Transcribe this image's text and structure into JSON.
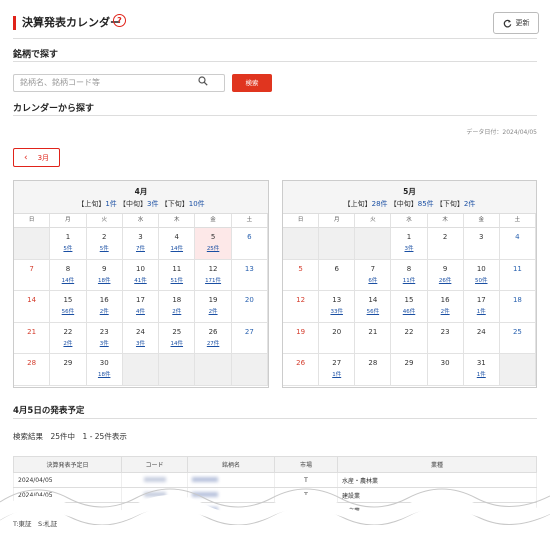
{
  "header": {
    "title": "決算発表カレンダー",
    "help_icon": "?",
    "refresh_label": "更新"
  },
  "search_section": {
    "heading": "銘柄で探す",
    "placeholder": "銘柄名、銘柄コード等",
    "button_label": "検索"
  },
  "calendar_section": {
    "heading": "カレンダーから探す",
    "data_date": "データ日付：2024/04/05",
    "prev_label": "3月"
  },
  "weekdays": [
    "日",
    "月",
    "火",
    "水",
    "木",
    "金",
    "土"
  ],
  "april": {
    "title": "4月",
    "sub": {
      "a": "【上旬】",
      "a_count": "1件",
      "b": "【中旬】",
      "b_count": "3件",
      "c": "【下旬】",
      "c_count": "10件"
    },
    "cells": [
      {
        "d": "",
        "c": ""
      },
      {
        "d": "1",
        "c": "5件"
      },
      {
        "d": "2",
        "c": "5件"
      },
      {
        "d": "3",
        "c": "7件"
      },
      {
        "d": "4",
        "c": "14件"
      },
      {
        "d": "5",
        "c": "25件"
      },
      {
        "d": "6",
        "c": ""
      },
      {
        "d": "7",
        "c": ""
      },
      {
        "d": "8",
        "c": "14件"
      },
      {
        "d": "9",
        "c": "18件"
      },
      {
        "d": "10",
        "c": "41件"
      },
      {
        "d": "11",
        "c": "51件"
      },
      {
        "d": "12",
        "c": "171件"
      },
      {
        "d": "13",
        "c": ""
      },
      {
        "d": "14",
        "c": ""
      },
      {
        "d": "15",
        "c": "56件"
      },
      {
        "d": "16",
        "c": "2件"
      },
      {
        "d": "17",
        "c": "4件"
      },
      {
        "d": "18",
        "c": "2件"
      },
      {
        "d": "19",
        "c": "2件"
      },
      {
        "d": "20",
        "c": ""
      },
      {
        "d": "21",
        "c": ""
      },
      {
        "d": "22",
        "c": "2件"
      },
      {
        "d": "23",
        "c": "3件"
      },
      {
        "d": "24",
        "c": "3件"
      },
      {
        "d": "25",
        "c": "14件"
      },
      {
        "d": "26",
        "c": "27件"
      },
      {
        "d": "27",
        "c": ""
      },
      {
        "d": "28",
        "c": ""
      },
      {
        "d": "29",
        "c": ""
      },
      {
        "d": "30",
        "c": "18件"
      },
      {
        "d": "",
        "c": ""
      },
      {
        "d": "",
        "c": ""
      },
      {
        "d": "",
        "c": ""
      },
      {
        "d": "",
        "c": ""
      }
    ]
  },
  "may": {
    "title": "5月",
    "sub": {
      "a": "【上旬】",
      "a_count": "28件",
      "b": "【中旬】",
      "b_count": "85件",
      "c": "【下旬】",
      "c_count": "2件"
    },
    "cells": [
      {
        "d": "",
        "c": ""
      },
      {
        "d": "",
        "c": ""
      },
      {
        "d": "",
        "c": ""
      },
      {
        "d": "1",
        "c": "3件"
      },
      {
        "d": "2",
        "c": ""
      },
      {
        "d": "3",
        "c": ""
      },
      {
        "d": "4",
        "c": ""
      },
      {
        "d": "5",
        "c": ""
      },
      {
        "d": "6",
        "c": ""
      },
      {
        "d": "7",
        "c": "6件"
      },
      {
        "d": "8",
        "c": "11件"
      },
      {
        "d": "9",
        "c": "26件"
      },
      {
        "d": "10",
        "c": "50件"
      },
      {
        "d": "11",
        "c": ""
      },
      {
        "d": "12",
        "c": ""
      },
      {
        "d": "13",
        "c": "33件"
      },
      {
        "d": "14",
        "c": "56件"
      },
      {
        "d": "15",
        "c": "46件"
      },
      {
        "d": "16",
        "c": "2件"
      },
      {
        "d": "17",
        "c": "1件"
      },
      {
        "d": "18",
        "c": ""
      },
      {
        "d": "19",
        "c": ""
      },
      {
        "d": "20",
        "c": ""
      },
      {
        "d": "21",
        "c": ""
      },
      {
        "d": "22",
        "c": ""
      },
      {
        "d": "23",
        "c": ""
      },
      {
        "d": "24",
        "c": ""
      },
      {
        "d": "25",
        "c": ""
      },
      {
        "d": "26",
        "c": ""
      },
      {
        "d": "27",
        "c": "1件"
      },
      {
        "d": "28",
        "c": ""
      },
      {
        "d": "29",
        "c": ""
      },
      {
        "d": "30",
        "c": ""
      },
      {
        "d": "31",
        "c": "1件"
      },
      {
        "d": "",
        "c": ""
      }
    ]
  },
  "schedule": {
    "heading": "4月5日の発表予定",
    "result": "検索結果　25件中　1 - 25件表示"
  },
  "table": {
    "headers": [
      "決算発表予定日",
      "コード",
      "銘柄名",
      "市場",
      "業種"
    ],
    "rows": [
      {
        "date": "2024/04/05",
        "market": "T",
        "sector": "水産・農林業"
      },
      {
        "date": "2024/04/05",
        "market": "T",
        "sector": "建設業"
      },
      {
        "date": "2024/04/05",
        "market": "T",
        "sector": "小売業"
      }
    ]
  },
  "footer_note": "T:東証　S:札証",
  "colors": {
    "accent": "#e0231a",
    "link": "#1a4fa3",
    "sunday": "#d43c2c",
    "saturday": "#2a62b0"
  }
}
